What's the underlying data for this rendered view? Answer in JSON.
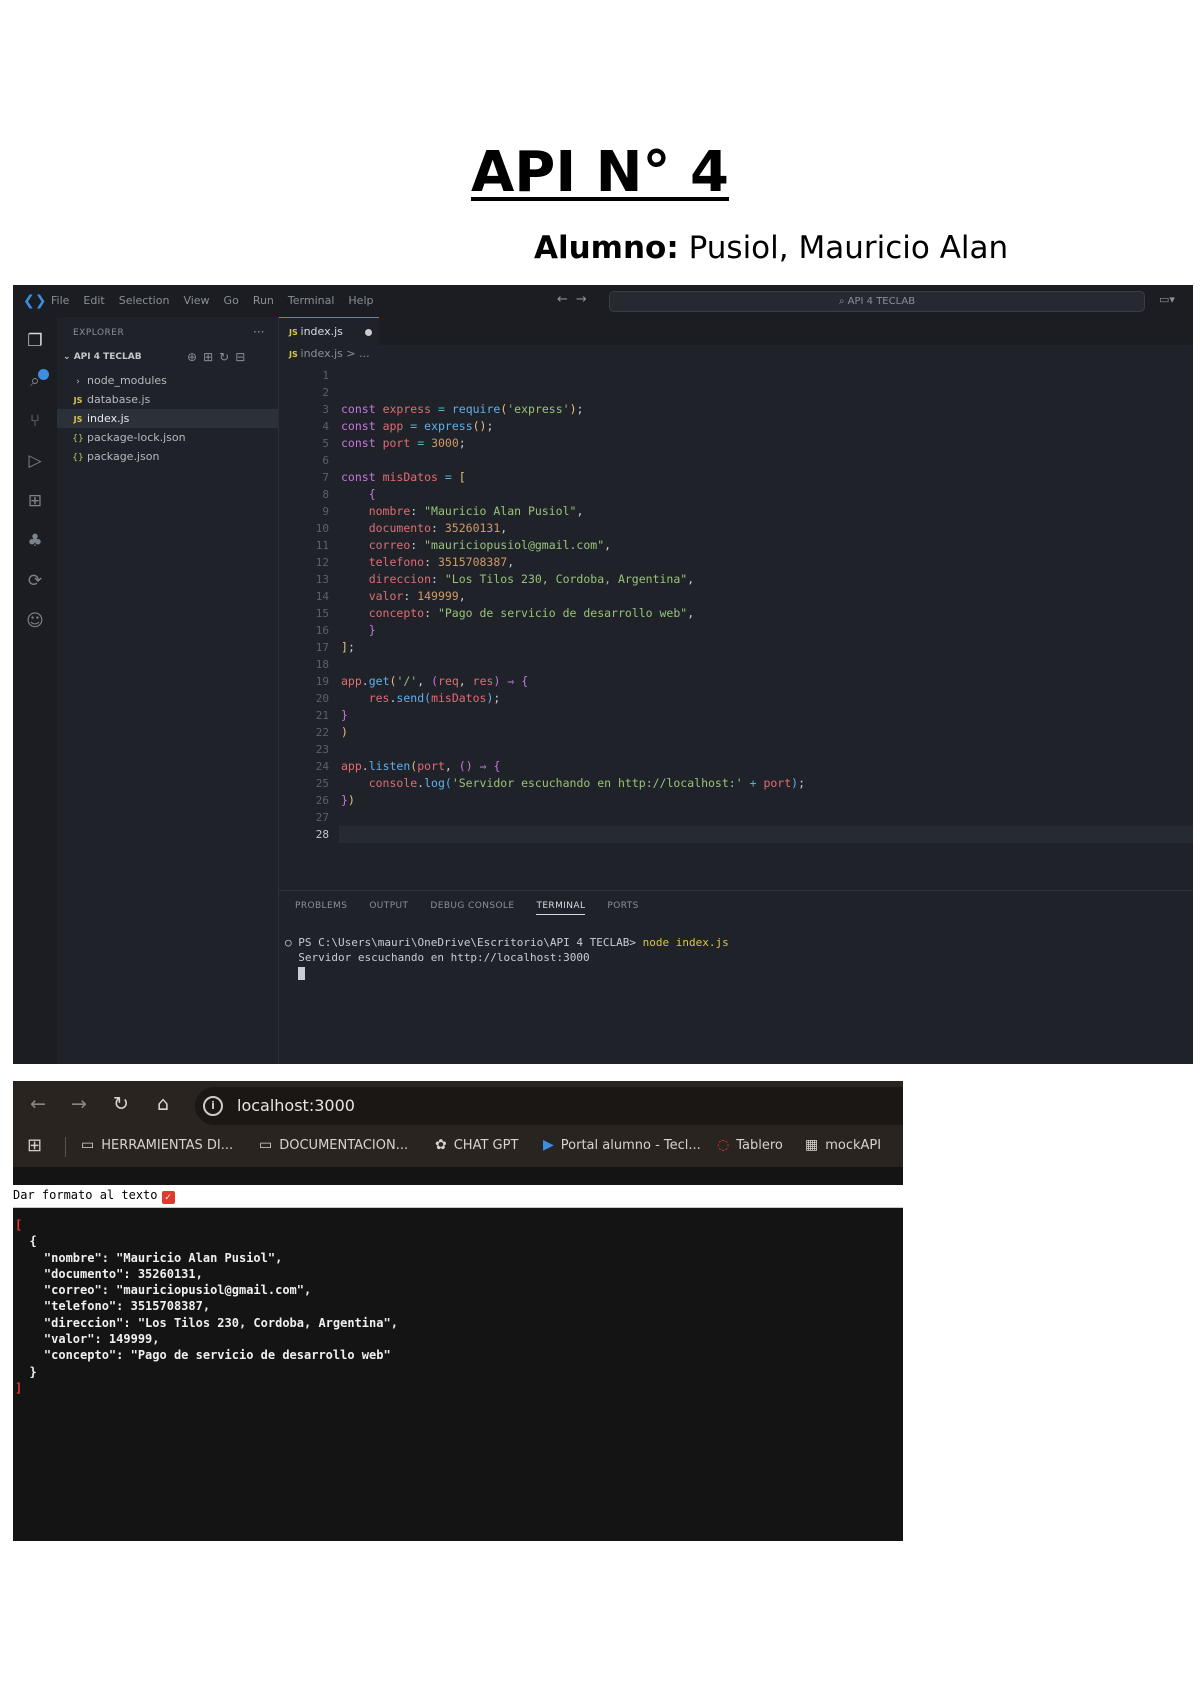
{
  "document": {
    "title": "API N° 4",
    "student_label": "Alumno:",
    "student_name": " Pusiol, Mauricio Alan"
  },
  "vscode": {
    "menu": [
      "File",
      "Edit",
      "Selection",
      "View",
      "Go",
      "Run",
      "Terminal",
      "Help"
    ],
    "command_center": "API 4 TECLAB",
    "explorer_title": "EXPLORER",
    "explorer_section": "API 4 TECLAB",
    "tree": [
      {
        "label": "node_modules",
        "kind": "folder"
      },
      {
        "label": "database.js",
        "kind": "js"
      },
      {
        "label": "index.js",
        "kind": "js",
        "selected": true
      },
      {
        "label": "package-lock.json",
        "kind": "json"
      },
      {
        "label": "package.json",
        "kind": "json"
      }
    ],
    "active_tab": "index.js",
    "breadcrumb": "index.js > ...",
    "panel_tabs": [
      "PROBLEMS",
      "OUTPUT",
      "DEBUG CONSOLE",
      "TERMINAL",
      "PORTS"
    ],
    "active_panel_tab": "TERMINAL",
    "terminal": {
      "prompt": "PS C:\\Users\\mauri\\OneDrive\\Escritorio\\API 4 TECLAB> ",
      "command": "node index.js",
      "output": "Servidor escuchando en http://localhost:3000"
    }
  },
  "browser": {
    "url": "localhost:3000",
    "bookmarks": [
      {
        "label": "HERRAMIENTAS DI...",
        "icon": "folder-icon"
      },
      {
        "label": "DOCUMENTACION...",
        "icon": "folder-icon"
      },
      {
        "label": "CHAT GPT",
        "icon": "chatgpt-icon"
      },
      {
        "label": "Portal alumno - Tecl...",
        "icon": "portal-icon"
      },
      {
        "label": "Tablero",
        "icon": "tablero-icon"
      },
      {
        "label": "mockAPI",
        "icon": "mockapi-icon"
      }
    ],
    "format_label": "Dar formato al texto",
    "json_response": {
      "nombre": "Mauricio Alan Pusiol",
      "documento": "35260131",
      "correo": "mauriciopusiol@gmail.com",
      "telefono": "3515708387",
      "direccion": "Los Tilos 230, Cordoba, Argentina",
      "valor": "149999",
      "concepto": "Pago de servicio de desarrollo web"
    }
  },
  "colors": {
    "vscode_bg": "#1f2228",
    "accent": "#3c8fe0",
    "browser_toolbar": "#2a2420",
    "check_red": "#e03a2f"
  }
}
